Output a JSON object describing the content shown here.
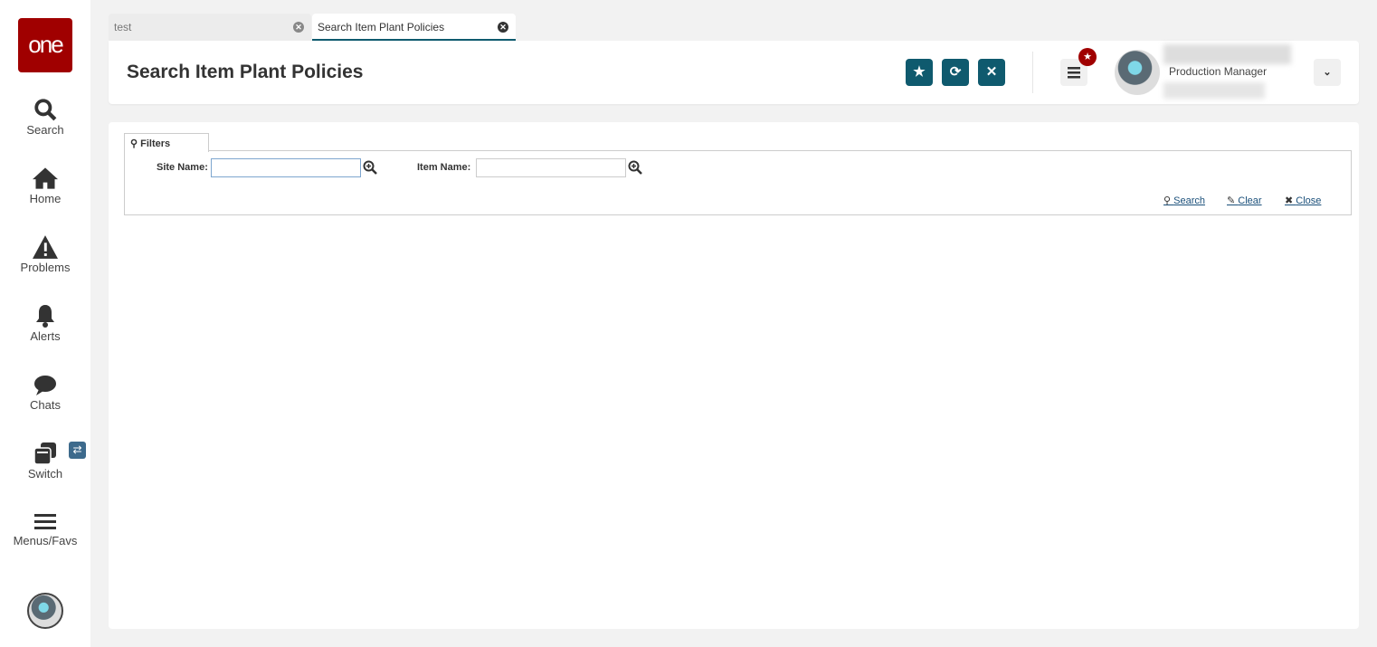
{
  "sidebar": {
    "logo": "one",
    "items": [
      {
        "label": "Search",
        "icon": "search-icon"
      },
      {
        "label": "Home",
        "icon": "home-icon"
      },
      {
        "label": "Problems",
        "icon": "warning-icon"
      },
      {
        "label": "Alerts",
        "icon": "bell-icon"
      },
      {
        "label": "Chats",
        "icon": "chat-icon"
      },
      {
        "label": "Switch",
        "icon": "switch-icon",
        "badge": "⇄"
      },
      {
        "label": "Menus/Favs",
        "icon": "menu-icon"
      }
    ]
  },
  "tabs": [
    {
      "label": "test",
      "active": false
    },
    {
      "label": "Search Item Plant Policies",
      "active": true
    }
  ],
  "header": {
    "title": "Search Item Plant Policies",
    "role": "Production Manager"
  },
  "filters": {
    "tab_label": "Filters",
    "site_label": "Site Name:",
    "site_value": "",
    "item_label": "Item Name:",
    "item_value": "",
    "search": "Search",
    "clear": "Clear",
    "close": "Close"
  },
  "colors": {
    "brand": "#a00000",
    "accent": "#0f5a6e"
  }
}
